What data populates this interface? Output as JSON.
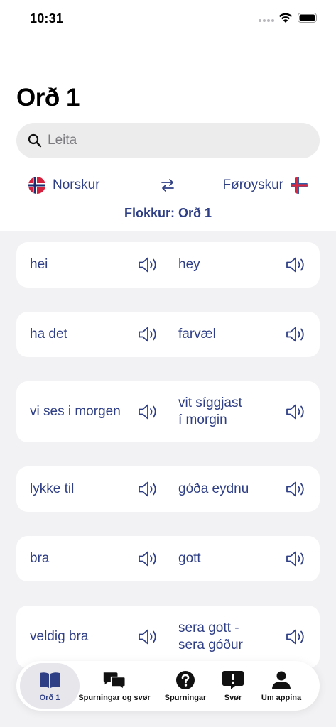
{
  "status": {
    "time": "10:31"
  },
  "page": {
    "title": "Orð 1"
  },
  "search": {
    "placeholder": "Leita"
  },
  "languages": {
    "left": "Norskur",
    "right": "Føroyskur",
    "left_flag_icon": "norway-flag-icon",
    "right_flag_icon": "faroe-flag-icon",
    "swap_icon": "swap-arrows-icon"
  },
  "group": {
    "label": "Flokkur: Orð 1"
  },
  "words": [
    {
      "left": "hei",
      "right": "hey"
    },
    {
      "left": "ha det",
      "right": "farvæl"
    },
    {
      "left": "vi ses i morgen",
      "right": "vit síggjast\ní morgin"
    },
    {
      "left": "lykke til",
      "right": "góða eydnu"
    },
    {
      "left": "bra",
      "right": "gott"
    },
    {
      "left": "veldig bra",
      "right": "sera gott -\nsera góður"
    }
  ],
  "tabs": [
    {
      "label": "Orð 1",
      "icon": "book-icon",
      "active": true
    },
    {
      "label": "Spurningar og svør",
      "icon": "chat-bubbles-icon",
      "active": false
    },
    {
      "label": "Spurningar",
      "icon": "question-circle-icon",
      "active": false
    },
    {
      "label": "Svør",
      "icon": "exclamation-bubble-icon",
      "active": false
    },
    {
      "label": "Um appina",
      "icon": "person-icon",
      "active": false
    }
  ],
  "colors": {
    "accent": "#2f3f86",
    "background": "#f2f2f4",
    "card": "#ffffff"
  }
}
